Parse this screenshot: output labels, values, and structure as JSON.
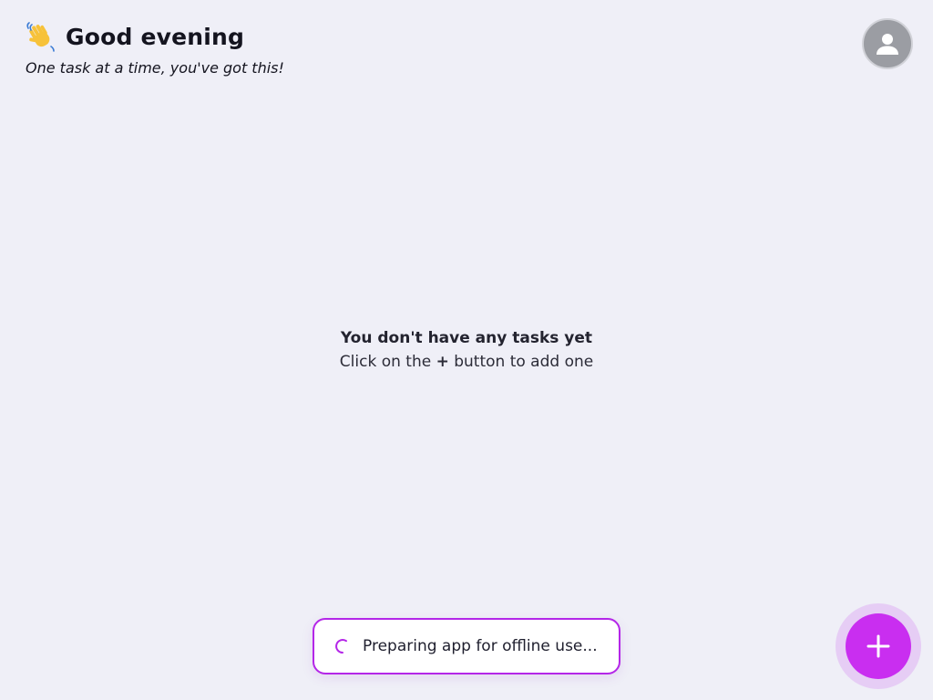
{
  "header": {
    "greeting": "Good evening",
    "tagline": "One task at a time, you've got this!",
    "greeting_icon": "waving-hand-icon"
  },
  "profile": {
    "icon": "person-icon"
  },
  "empty_state": {
    "title": "You don't have any tasks yet",
    "subtitle_before": "Click on the",
    "subtitle_plus": "+",
    "subtitle_after": "button to add one"
  },
  "toast": {
    "text": "Preparing app for offline use..."
  },
  "fab": {
    "icon": "plus-icon"
  },
  "colors": {
    "background": "#efeff7",
    "accent": "#c92ef0",
    "toast_border": "#b426e8",
    "avatar": "#9b9da3"
  }
}
